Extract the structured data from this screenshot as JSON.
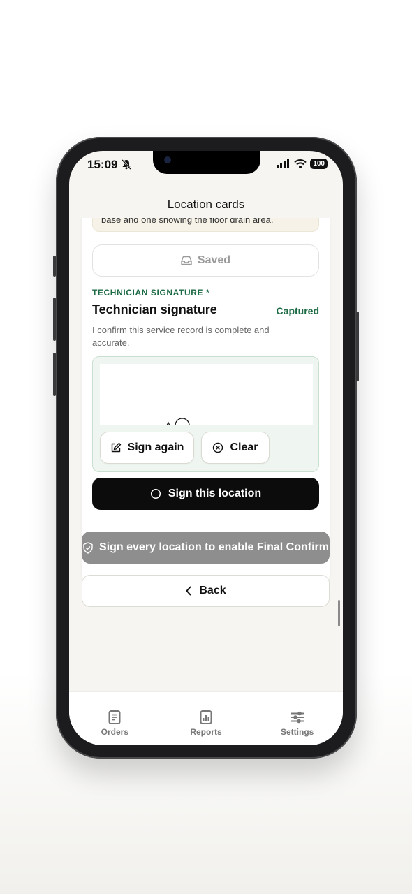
{
  "status_bar": {
    "time": "15:09",
    "battery": "100"
  },
  "header": {
    "title": "Location cards"
  },
  "note": {
    "text": "base and one showing the floor drain area."
  },
  "saved_button": {
    "label": "Saved"
  },
  "signature": {
    "section_label": "TECHNICIAN SIGNATURE *",
    "title": "Technician signature",
    "status": "Captured",
    "confirm_text": "I confirm this service record is complete and accurate.",
    "sign_again_label": "Sign again",
    "clear_label": "Clear",
    "sign_location_label": "Sign this location"
  },
  "final_confirm": {
    "label": "Sign every location to enable Final Confirm"
  },
  "back": {
    "label": "Back"
  },
  "tabs": [
    {
      "label": "Orders",
      "icon": "orders-icon"
    },
    {
      "label": "Reports",
      "icon": "reports-icon"
    },
    {
      "label": "Settings",
      "icon": "settings-icon"
    }
  ],
  "colors": {
    "accent_green": "#1d6b45",
    "primary_dark": "#0c0c0c",
    "disabled_gray": "#8e8e8e"
  }
}
